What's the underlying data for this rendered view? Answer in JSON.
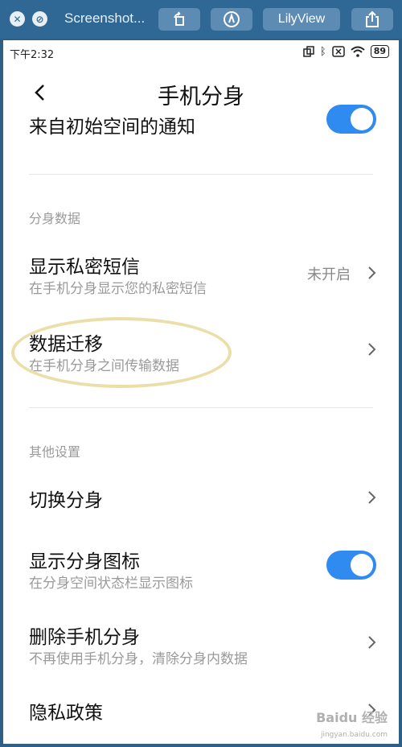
{
  "viewer": {
    "title": "Screenshot...",
    "app_button": "LilyView",
    "close_icon": "close-icon",
    "minimize_icon": "minimize-icon"
  },
  "status": {
    "time": "下午2:32",
    "battery": "89"
  },
  "header": {
    "title": "手机分身"
  },
  "top_row": {
    "title": "来自初始空间的通知",
    "toggle_on": true
  },
  "sections": {
    "data_label": "分身数据",
    "other_label": "其他设置"
  },
  "rows": {
    "private_sms": {
      "title": "显示私密短信",
      "subtitle": "在手机分身显示您的私密短信",
      "value": "未开启"
    },
    "migration": {
      "title": "数据迁移",
      "subtitle": "在手机分身之间传输数据"
    },
    "switch": {
      "title": "切换分身"
    },
    "show_icon": {
      "title": "显示分身图标",
      "subtitle": "在分身空间状态栏显示图标",
      "toggle_on": true
    },
    "delete": {
      "title": "删除手机分身",
      "subtitle": "不再使用手机分身，清除分身内数据"
    },
    "privacy": {
      "title": "隐私政策"
    }
  },
  "watermark": {
    "text": "Baidu 经验",
    "sub": "jingyan.baidu.com"
  },
  "colors": {
    "accent": "#2f8bf0",
    "viewer_bar": "#2f6894",
    "highlight": "#eadfa8"
  }
}
